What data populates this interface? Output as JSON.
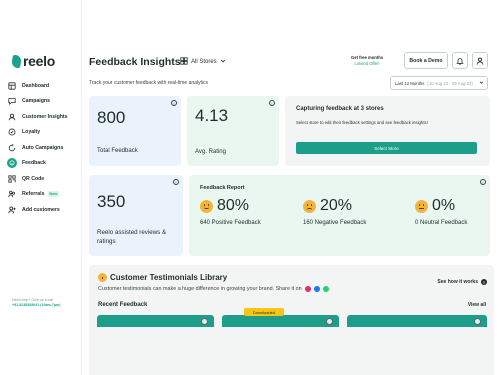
{
  "brand": {
    "name": "reelo"
  },
  "sidebar": {
    "items": [
      {
        "label": "Dashboard",
        "icon": "dashboard-icon"
      },
      {
        "label": "Campaigns",
        "icon": "campaign-icon"
      },
      {
        "label": "Customer Insights",
        "icon": "insights-icon"
      },
      {
        "label": "Loyalty",
        "icon": "loyalty-icon"
      },
      {
        "label": "Auto Campaigns",
        "icon": "auto-campaign-icon"
      },
      {
        "label": "Feedback",
        "icon": "feedback-icon",
        "active": true
      },
      {
        "label": "QR Code",
        "icon": "qr-code-icon"
      },
      {
        "label": "Referrals",
        "icon": "referrals-icon",
        "badge": "New"
      },
      {
        "label": "Add customers",
        "icon": "add-user-icon"
      }
    ],
    "help_text": "Need help? Give us a call",
    "help_phone": "+91-8238369641 (10am-7pm)"
  },
  "header": {
    "title": "Feedback Insights",
    "store_selector": "All Stores",
    "subtitle": "Track your customer feedback with real-time analytics",
    "free_months_line1": "Get free months",
    "free_months_line2": "Limited Offer!",
    "demo_button": "Book a Demo",
    "date_range_label": "Last 12 Months",
    "date_range_dates": "(10 Aug 22 - 09 Aug 23)"
  },
  "stats": {
    "total_feedback": {
      "value": "800",
      "label": "Total Feedback"
    },
    "avg_rating": {
      "value": "4.13",
      "label": "Avg. Rating"
    },
    "reelo_assisted": {
      "value": "350",
      "label": "Reelo assisted reviews & ratings"
    }
  },
  "capture": {
    "title": "Capturing feedback at 3 stores",
    "description": "Select store to edit their feedback settings and see feedback insights!",
    "button": "Select Store"
  },
  "report": {
    "title": "Feedback Report",
    "items": [
      {
        "percent": "80%",
        "label": "640 Positive Feedback",
        "mood": "positive"
      },
      {
        "percent": "20%",
        "label": "160 Negative Feedback",
        "mood": "negative"
      },
      {
        "percent": "0%",
        "label": "0 Neutral Feedback",
        "mood": "neutral"
      }
    ]
  },
  "testimonials": {
    "title": "Customer Testimonials Library",
    "subtitle": "Customer testimonials can make a huge difference in growing your brand. Share it on",
    "how_it_works": "See how it works",
    "recent": "Recent Feedback",
    "view_all": "View all",
    "downloaded_badge": "Downloaded"
  },
  "colors": {
    "accent": "#1aa38a",
    "blue_card": "#eaf3fc",
    "green_card": "#eaf7f1",
    "gray_card": "#f3f5f5"
  }
}
